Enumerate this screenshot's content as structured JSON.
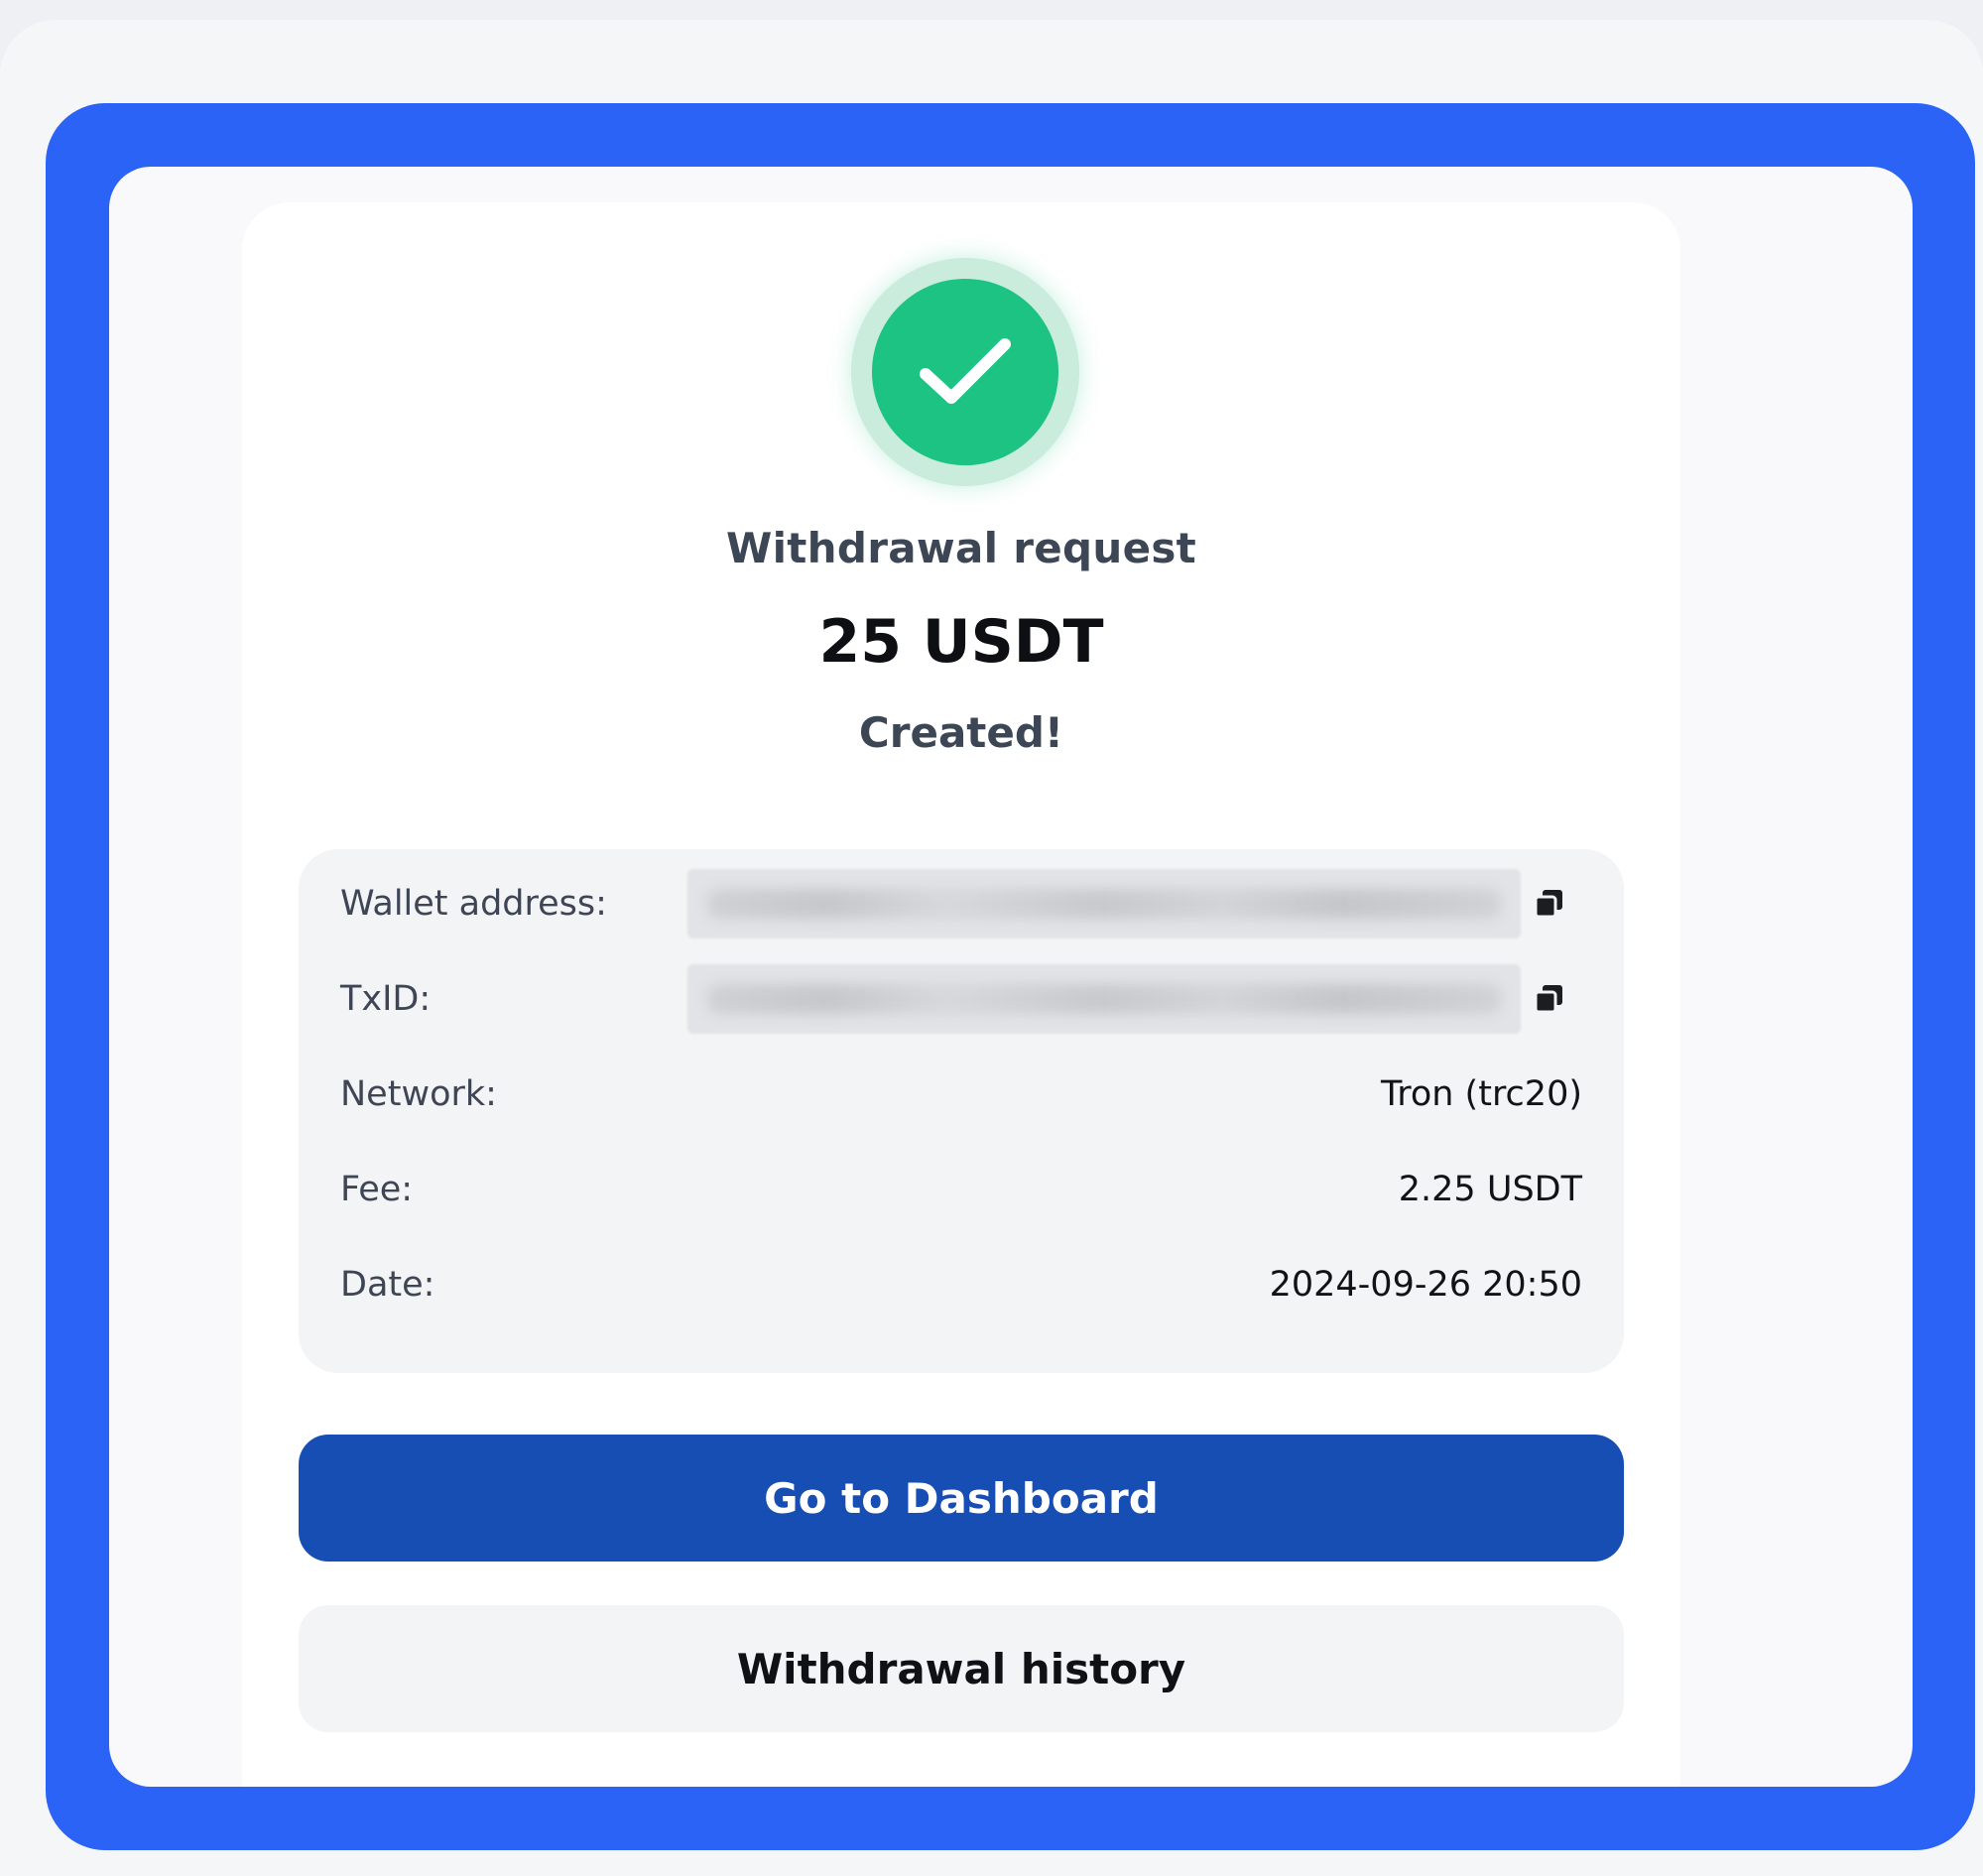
{
  "receipt": {
    "title": "Withdrawal request",
    "amount": "25 USDT",
    "status": "Created!"
  },
  "details": {
    "wallet_label": "Wallet address:",
    "txid_label": "TxID:",
    "network_label": "Network:",
    "network_value": "Tron (trc20)",
    "fee_label": "Fee:",
    "fee_value": "2.25 USDT",
    "date_label": "Date:",
    "date_value": "2024-09-26 20:50"
  },
  "actions": {
    "primary_label": "Go to Dashboard",
    "secondary_label": "Withdrawal history"
  },
  "icons": {
    "success": "check-icon",
    "copy": "copy-icon"
  },
  "colors": {
    "frame": "#2b63f6",
    "success": "#1dc383",
    "primary_button": "#174eb3"
  }
}
